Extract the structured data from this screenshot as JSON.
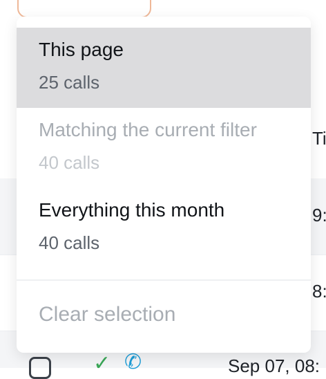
{
  "menu": {
    "items": [
      {
        "title": "This page",
        "count": "25 calls",
        "state": "active"
      },
      {
        "title": "Matching the current filter",
        "count": "40 calls",
        "state": "disabled"
      },
      {
        "title": "Everything this month",
        "count": "40 calls",
        "state": "enabled"
      }
    ],
    "clear_label": "Clear selection"
  },
  "background": {
    "col_header_fragment": "Ti",
    "row1_time_fragment": "9:",
    "row2_time_fragment": "8:",
    "row3_date_fragment": "Sep 07, 08:"
  },
  "icons": {
    "row_checkbox": "checkbox-icon",
    "answered": "check-icon",
    "call_type": "phone-icon"
  }
}
